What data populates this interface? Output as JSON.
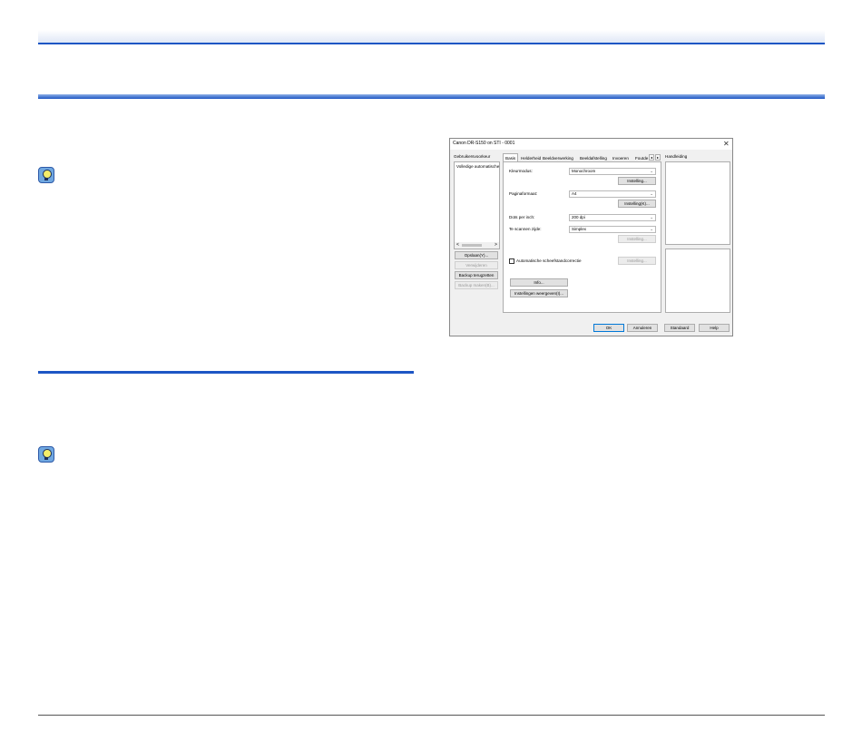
{
  "dialog": {
    "title": "Canon DR-S150 on STI - 0001",
    "close": "✕",
    "left": {
      "settings_label": "Gebruikersvoorkeur",
      "list_item": "Volledige automatische",
      "scroll_left": "<",
      "scroll_right": ">",
      "save_button": "Opslaan(Y)...",
      "delete_button": "Verwijderen",
      "backup_restore_button": "Backup terugzetten",
      "backup_create_button": "Backup maken(B)..."
    },
    "tabs": [
      "Basis",
      "Helderheid",
      "Beeldverwerking",
      "Beeldafstelling",
      "Invoeren",
      "Foutde"
    ],
    "tab_scroll_left": "◂",
    "tab_scroll_right": "▸",
    "basic": {
      "color_mode_label": "Kleurmodus:",
      "color_mode_value": "Monochroom",
      "settings_button_1": "Instelling...",
      "page_size_label": "Paginaformaat:",
      "page_size_value": "A4",
      "settings_button_2": "Instelling(K)...",
      "dpi_label": "Dots per inch:",
      "dpi_value": "200 dpi",
      "scan_side_label": "Te scannen zijde:",
      "scan_side_value": "Simplex",
      "settings_button_3": "Instelling...",
      "deskew_label": "Automatische scheefstandcorrectie",
      "deskew_checked": false,
      "settings_button_4": "Instelling...",
      "info_button": "Info...",
      "restore_button": "Instellingen weergeven(I)..."
    },
    "manual_label": "Handleiding",
    "footer": {
      "ok": "OK",
      "cancel": "Annuleren",
      "default": "Standaard",
      "help": "Help"
    }
  }
}
